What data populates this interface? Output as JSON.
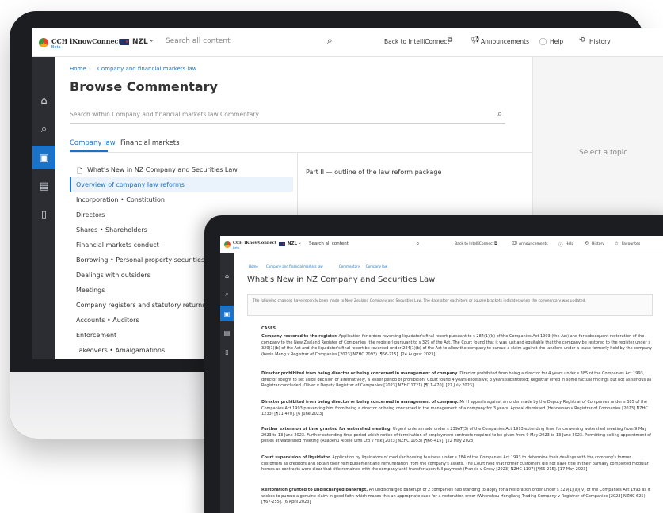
{
  "app": {
    "logo_text": "CCH iKnowConnect",
    "logo_sub": "Beta",
    "jurisdiction": "NZL",
    "search_placeholder": "Search all content",
    "back_link": "Back to IntelliConnect",
    "announcements": "Announcements",
    "help": "Help",
    "history": "History",
    "favourites": "Favourites"
  },
  "back_screen": {
    "breadcrumb_home": "Home",
    "breadcrumb_current": "Company and financial markets law",
    "title": "Browse Commentary",
    "search_placeholder": "Search within Company and financial markets law Commentary",
    "tabs": [
      "Company law",
      "Financial markets"
    ],
    "tree": [
      "What's New in NZ Company and Securities Law",
      "Overview of company law reforms",
      "Incorporation • Constitution",
      "Directors",
      "Shares • Shareholders",
      "Financial markets conduct",
      "Borrowing • Personal property securities",
      "Dealings with outsiders",
      "Meetings",
      "Company registers and statutory returns",
      "Accounts • Auditors",
      "Enforcement",
      "Takeovers • Amalgamations"
    ],
    "content_heading": "Part II — outline of the law reform package",
    "right_panel_text": "Select a topic"
  },
  "front_screen": {
    "breadcrumb": [
      "Home",
      "Company and financial markets law",
      "Commentary",
      "Company law"
    ],
    "title": "What's New in NZ Company and Securities Law",
    "notice": "The following changes have recently been made to New Zealand Company and Securities Law. The date after each item or square brackets indicates when the commentary was updated.",
    "section": "CASES",
    "cases": [
      {
        "title": "Company restored to the register.",
        "text": "Application for orders reversing liquidator's final report pursuant to s 284(1)(b) of the Companies Act 1993 (the Act) and for subsequent restoration of the company to the New Zealand Register of Companies (the register) pursuant to s 329 of the Act. The Court found that it was just and equitable that the company be restored to the register under s 329(1)(b) of the Act and the liquidator's final report be reversed under 284(1)(b) of the Act to allow the company to pursue a claim against the landlord under a lease formerly held by the company (Kevin Meng v Registrar of Companies [2023] NZHC 2093) [¶66-215]. [24 August 2023]"
      },
      {
        "title": "Director prohibited from being director or being concerned in management of company.",
        "text": "Director prohibited from being a director for 4 years under s 385 of the Companies Act 1993, director sought to set aside decision or alternatively, a lesser period of prohibition; Court found 4 years excessive; 3 years substituted; Registrar erred in some factual findings but not as serious as Registrar concluded (Oliver v Deputy Registrar of Companies [2023] NZHC 1721) [¶11-470]. [27 July 2023]"
      },
      {
        "title": "Director prohibited from being director or being concerned in management of company.",
        "text": "Mr H appeals against an order made by the Deputy Registrar of Companies under s 385 of the Companies Act 1993 preventing him from being a director or being concerned in the management of a company for 3 years. Appeal dismissed (Henderson v Registrar of Companies [2023] NZHC 1233) [¶11-470]. [6 June 2023]"
      },
      {
        "title": "Further extension of time granted for watershed meeting.",
        "text": "Urgent orders made under s 239AT(3) of the Companies Act 1993 extending time for convening watershed meeting from 9 May 2023 to 13 June 2023. Further extending time period which notice of termination of employment contracts required to be given from 9 May 2023 to 13 June 2023. Permitting selling appointment of posies at watershed meeting (Ruapehu Alpine Lifts Ltd v Fisk [2023] NZHC 1053) [¶66-415]. [22 May 2023]"
      },
      {
        "title": "Court supervision of liquidator.",
        "text": "Application by liquidators of modular housing business under s 284 of the Companies Act 1993 to determine their dealings with the company's former customers as creditors and obtain their reimbursement and remuneration from the company's assets. The Court held that former customers did not have title in their partially completed modular homes as contracts were clear that title remained with the company until transfer upon full payment (Francis v Gresy [2023] NZHC 1107) [¶66-215]. [17 May 2023]"
      },
      {
        "title": "Restoration granted to undischarged bankrupt.",
        "text": "An undischarged bankrupt of 2 companies had standing to apply for a restoration order under s 329(1)(a)(iv) of the Companies Act 1993 as it wishes to pursue a genuine claim in good faith which makes this an appropriate case for a restoration order (Whenshou Hongliang Trading Company v Registrar of Companies [2023] NZHC 625) [¶67-255]. [6 April 2023]"
      }
    ]
  }
}
